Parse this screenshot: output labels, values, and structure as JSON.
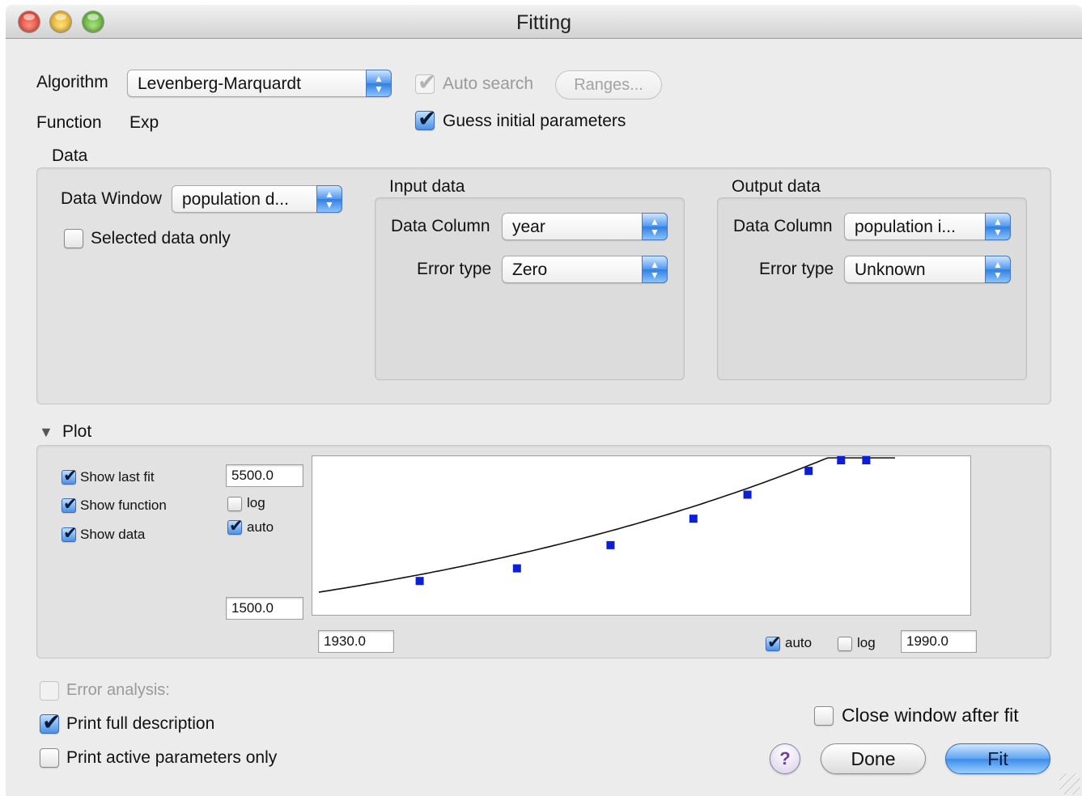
{
  "window": {
    "title": "Fitting"
  },
  "algorithm": {
    "label": "Algorithm",
    "value": "Levenberg-Marquardt",
    "auto_search": {
      "label": "Auto search",
      "checked": true,
      "enabled": false
    },
    "ranges_button": "Ranges...",
    "guess_initial": {
      "label": "Guess initial parameters",
      "checked": true
    }
  },
  "function": {
    "label": "Function",
    "value": "Exp"
  },
  "data_section": {
    "title": "Data",
    "data_window": {
      "label": "Data Window",
      "value": "population d..."
    },
    "selected_only": {
      "label": "Selected data only",
      "checked": false
    },
    "input": {
      "title": "Input data",
      "column_label": "Data Column",
      "column_value": "year",
      "error_label": "Error type",
      "error_value": "Zero"
    },
    "output": {
      "title": "Output data",
      "column_label": "Data Column",
      "column_value": "population i...",
      "error_label": "Error type",
      "error_value": "Unknown"
    }
  },
  "plot": {
    "title": "Plot",
    "show_last_fit": {
      "label": "Show last fit",
      "checked": true
    },
    "show_function": {
      "label": "Show function",
      "checked": true
    },
    "show_data": {
      "label": "Show data",
      "checked": true
    },
    "y_max": "5500.0",
    "y_min": "1500.0",
    "y_log": {
      "label": "log",
      "checked": false
    },
    "y_auto": {
      "label": "auto",
      "checked": true
    },
    "x_min": "1930.0",
    "x_max": "1990.0",
    "x_auto": {
      "label": "auto",
      "checked": true
    },
    "x_log": {
      "label": "log",
      "checked": false
    },
    "colors": {
      "curve": "#111111",
      "points": "#0a1fd6"
    }
  },
  "chart_data": {
    "type": "scatter",
    "xlim": [
      1930,
      1990
    ],
    "ylim": [
      1500,
      5500
    ],
    "points": {
      "x": [
        1944,
        1957.5,
        1970.5,
        1982,
        1989.5,
        1998,
        2002.5,
        2006
      ],
      "y": [
        2385,
        2700,
        3280,
        3940,
        4540,
        5135,
        5900,
        6295
      ]
    },
    "curve": {
      "x": [
        1930,
        1945,
        1960,
        1975,
        1990,
        2005,
        2010
      ],
      "y": [
        2105,
        2389,
        2818,
        3468,
        4390,
        5648,
        6195
      ]
    }
  },
  "options": {
    "error_analysis": {
      "label": "Error analysis:",
      "checked": false,
      "enabled": false
    },
    "print_full": {
      "label": "Print full description",
      "checked": true
    },
    "print_active": {
      "label": "Print active parameters only",
      "checked": false
    },
    "close_after_fit": {
      "label": "Close window after fit",
      "checked": false
    }
  },
  "buttons": {
    "help": "?",
    "done": "Done",
    "fit": "Fit"
  }
}
